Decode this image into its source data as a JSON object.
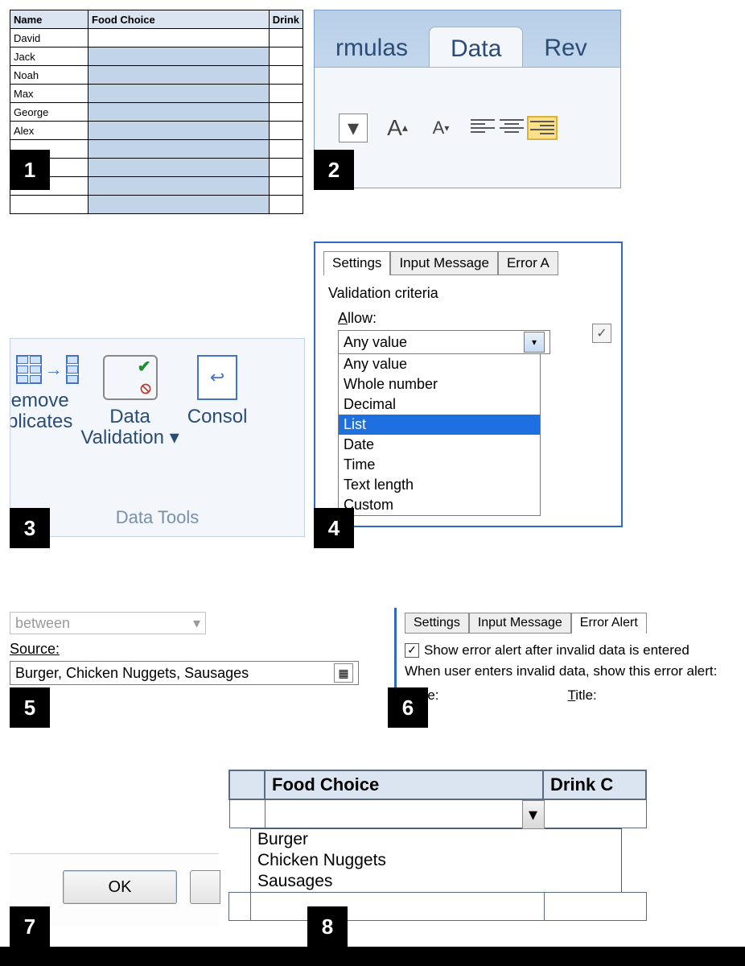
{
  "badges": {
    "1": "1",
    "2": "2",
    "3": "3",
    "4": "4",
    "5": "5",
    "6": "6",
    "7": "7",
    "8": "8"
  },
  "panel1": {
    "headers": {
      "name": "Name",
      "food": "Food Choice",
      "drink": "Drink"
    },
    "rows": [
      "David",
      "Jack",
      "Noah",
      "Max",
      "George",
      "Alex"
    ]
  },
  "panel2": {
    "tabs": {
      "formulas": "rmulas",
      "data": "Data",
      "review": "Rev"
    }
  },
  "panel3": {
    "remove": "emove",
    "duplicates": "plicates",
    "validation1": "Data",
    "validation2": "Validation",
    "consolidate": "Consol",
    "group": "Data Tools"
  },
  "panel4": {
    "tabs": {
      "settings": "Settings",
      "input": "Input Message",
      "error": "Error A"
    },
    "criteria": "Validation criteria",
    "allow_label": "Allow:",
    "allow_value": "Any value",
    "options": [
      "Any value",
      "Whole number",
      "Decimal",
      "List",
      "Date",
      "Time",
      "Text length",
      "Custom"
    ],
    "selected_option_index": 3
  },
  "panel5": {
    "between": "between",
    "source_label": "Source:",
    "source_value": "Burger, Chicken Nuggets, Sausages"
  },
  "panel6": {
    "tabs": {
      "settings": "Settings",
      "input": "Input Message",
      "error": "Error Alert"
    },
    "show_alert": "Show error alert after invalid data is entered",
    "when_text": "When user enters invalid data, show this error alert:",
    "style_label": "Style:",
    "title_label": "Title:"
  },
  "panel7": {
    "ok": "OK"
  },
  "panel8": {
    "headers": {
      "food": "Food Choice",
      "drink": "Drink C"
    },
    "options": [
      "Burger",
      "Chicken Nuggets",
      "Sausages"
    ]
  }
}
